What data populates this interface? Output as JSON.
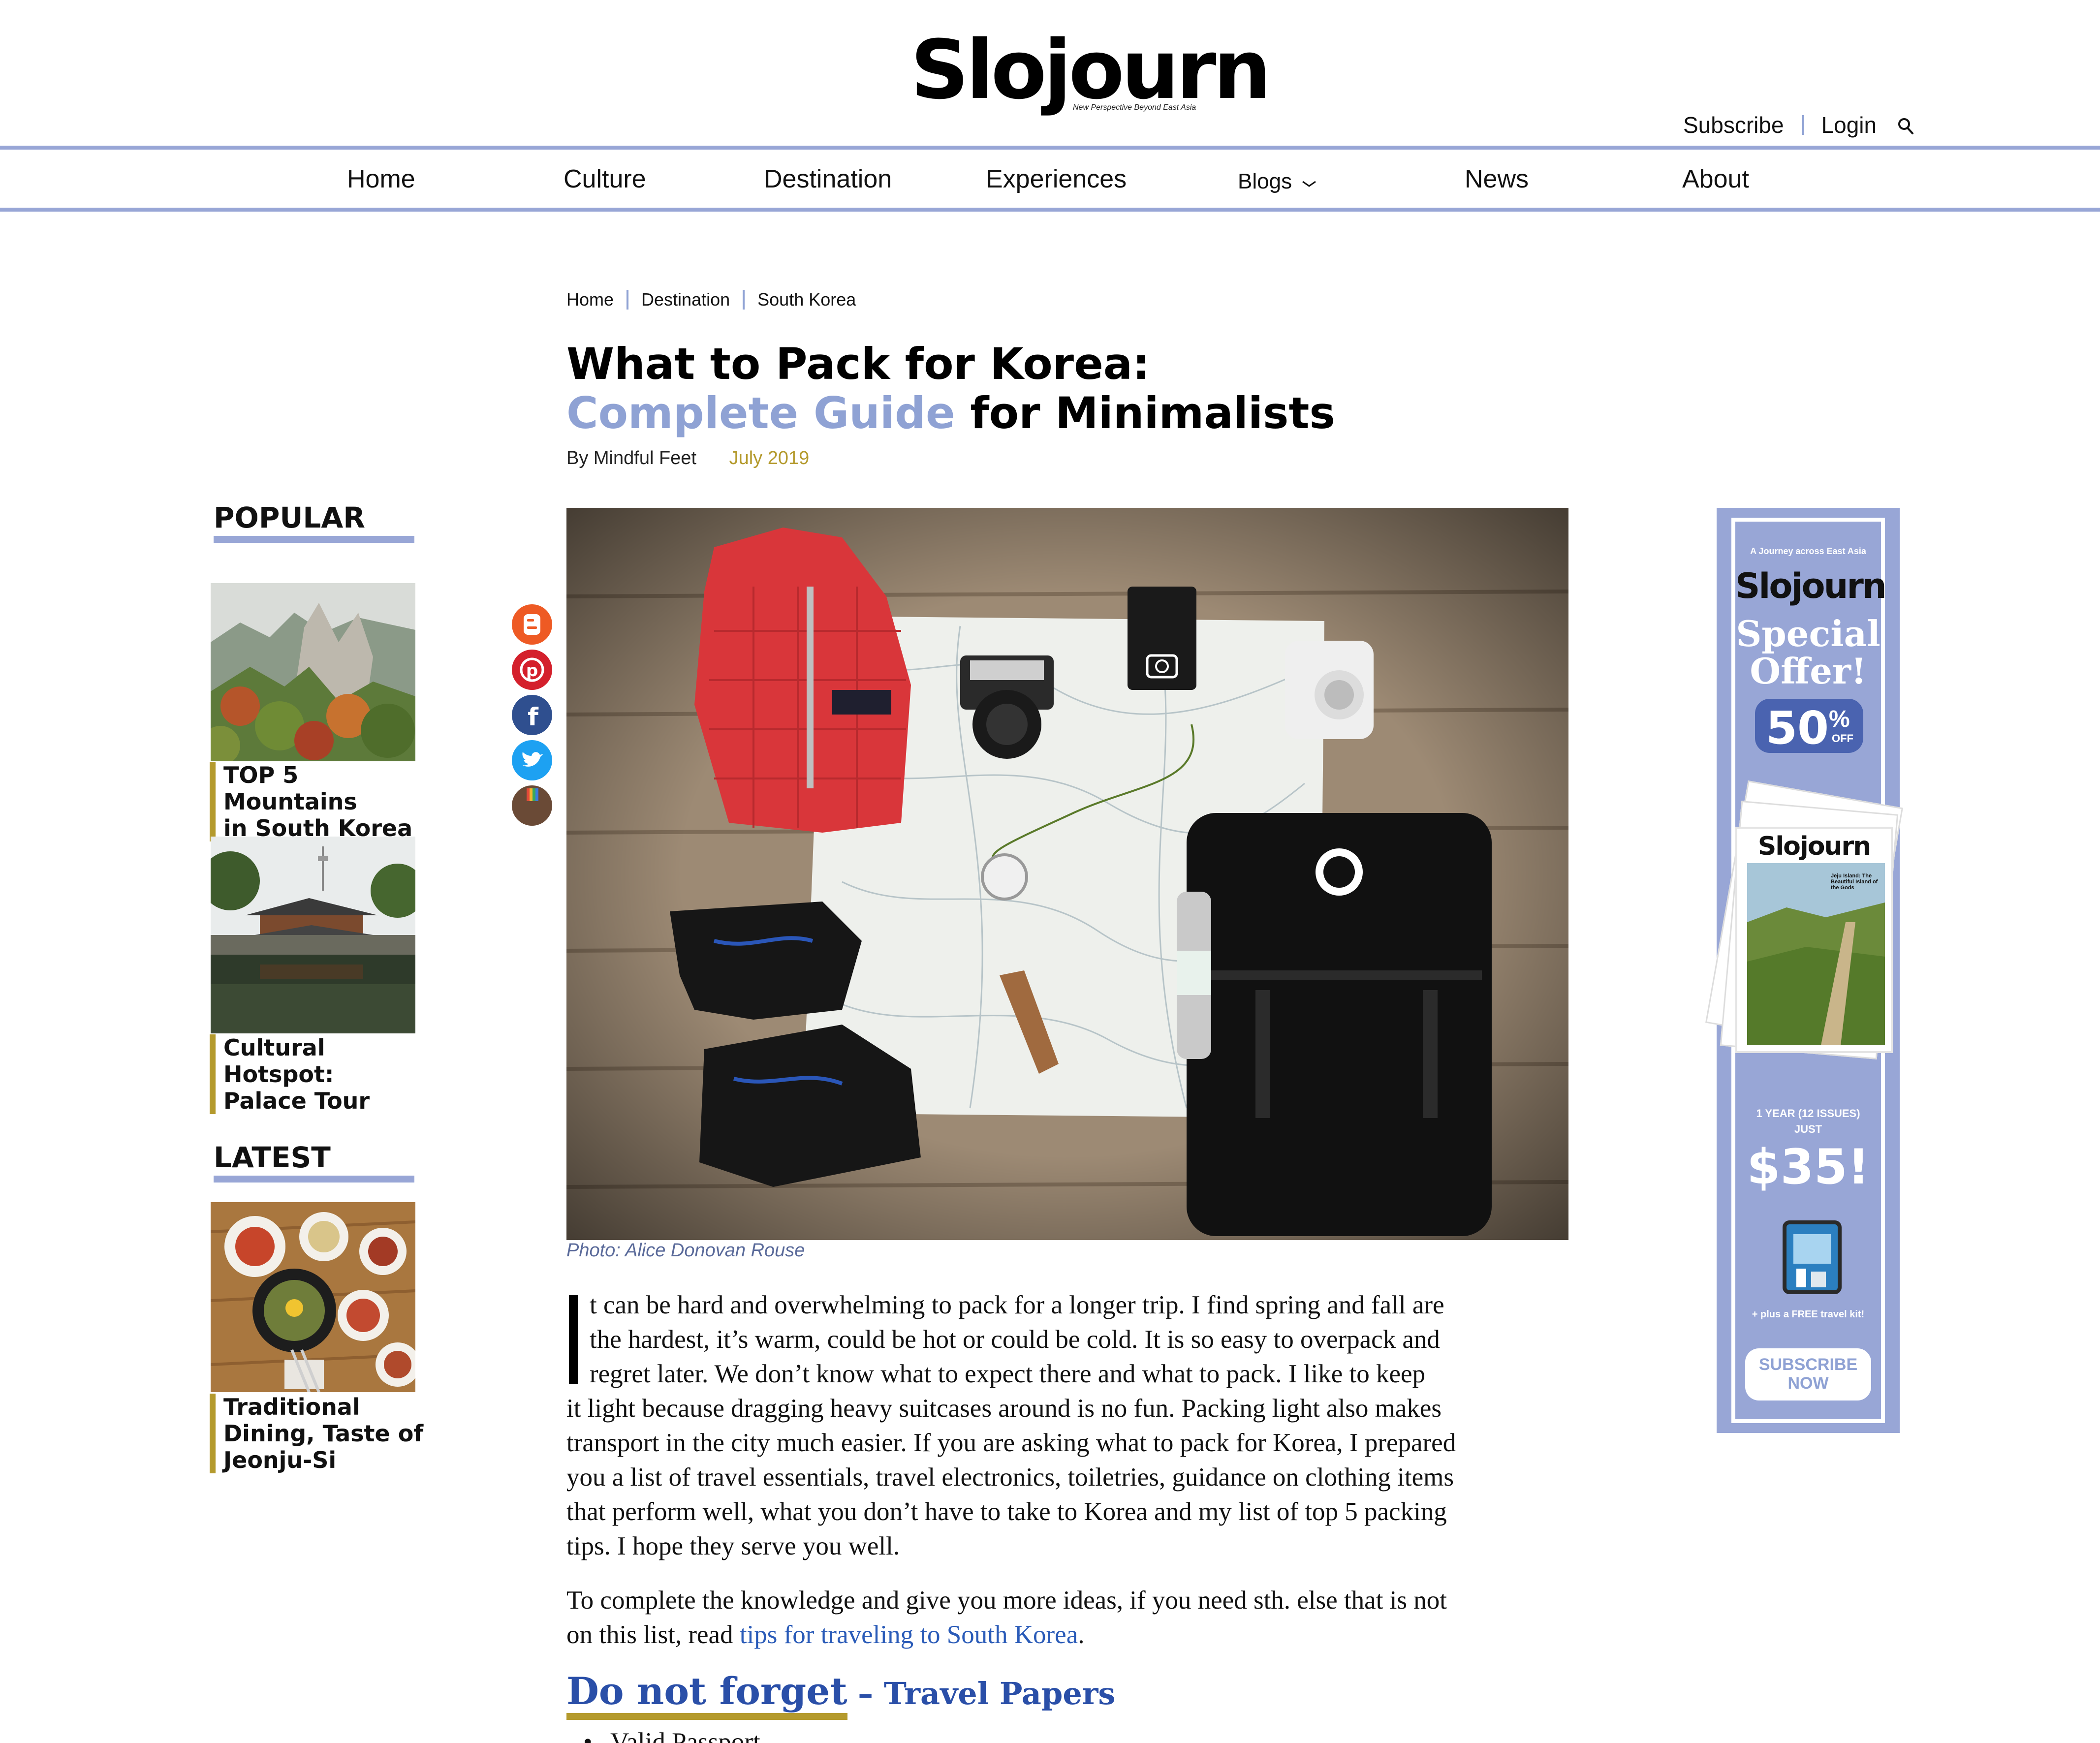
{
  "brand": {
    "name": "Slojourn",
    "tagline": "New Perspective Beyond East Asia"
  },
  "header": {
    "subscribe": "Subscribe",
    "login": "Login",
    "search_icon": "search-icon"
  },
  "nav": {
    "items": [
      "Home",
      "Culture",
      "Destination",
      "Experiences",
      "Blogs",
      "News",
      "About"
    ]
  },
  "sidebar": {
    "popular_heading": "POPULAR",
    "popular": [
      {
        "title_line1": "TOP 5 Mountains",
        "title_line2": "in South Korea"
      },
      {
        "title_line1": "Cultural Hotspot:",
        "title_line2": "Palace Tour"
      }
    ],
    "latest_heading": "LATEST",
    "latest": [
      {
        "title_line1": "Traditional",
        "title_line2": "Dining, Taste of",
        "title_line3": "Jeonju-Si"
      }
    ]
  },
  "breadcrumb": [
    "Home",
    "Destination",
    "South Korea"
  ],
  "article": {
    "title_line1": "What to Pack for Korea:",
    "title_accent": "Complete Guide",
    "title_rest": " for Minimalists",
    "author": "By Mindful Feet",
    "date": "July 2019",
    "photo_caption": "Photo: Alice Donovan Rouse",
    "p1_lines": [
      "t can be hard and overwhelming to pack for a longer trip. I find spring and fall are",
      "the hardest, it’s warm, could be hot or could be cold. It is so easy to overpack and",
      "regret later. We don’t know what to expect there and what to pack. I like to keep",
      "it light because dragging heavy suitcases around is no fun. Packing light also makes",
      "transport in the city much easier. If you are asking what to pack for Korea, I prepared",
      "you a list of travel essentials, travel electronics, toiletries, guidance on clothing items",
      "that perform well, what you don’t have to take to Korea and my list of top 5 packing",
      "tips. I hope they serve you well."
    ],
    "p2_line1": "To complete the knowledge and give you more ideas, if you need sth. else that is not",
    "p2_line2_text": "on this list, read ",
    "p2_link": "tips for traveling to South Korea",
    "p2_end": ".",
    "subheading_main": "Do not forget",
    "subheading_rest": " – Travel Papers",
    "bullet1": "Valid Passport"
  },
  "share_icons": [
    "blogger-icon",
    "pinterest-icon",
    "facebook-icon",
    "twitter-icon",
    "instagram-icon"
  ],
  "ad": {
    "kicker": "A Journey across East Asia",
    "brand": "Slojourn",
    "headline_line1": "Special",
    "headline_line2": "Offer!",
    "discount": "50",
    "discount_pct": "%",
    "discount_off": "OFF",
    "mag_title": "Slojourn",
    "mag_feature": "Jeju Island: The Beautiful Island of the Gods",
    "term_line1": "1 YEAR (12 ISSUES)",
    "term_line2": "JUST",
    "price": "$35!",
    "bonus": "+ plus a FREE travel kit!",
    "cta_line1": "SUBSCRIBE",
    "cta_line2": "NOW"
  },
  "colors": {
    "accent_blue": "#98a6d6",
    "accent_gold": "#b49a2d",
    "link_blue": "#2a5bb8"
  }
}
